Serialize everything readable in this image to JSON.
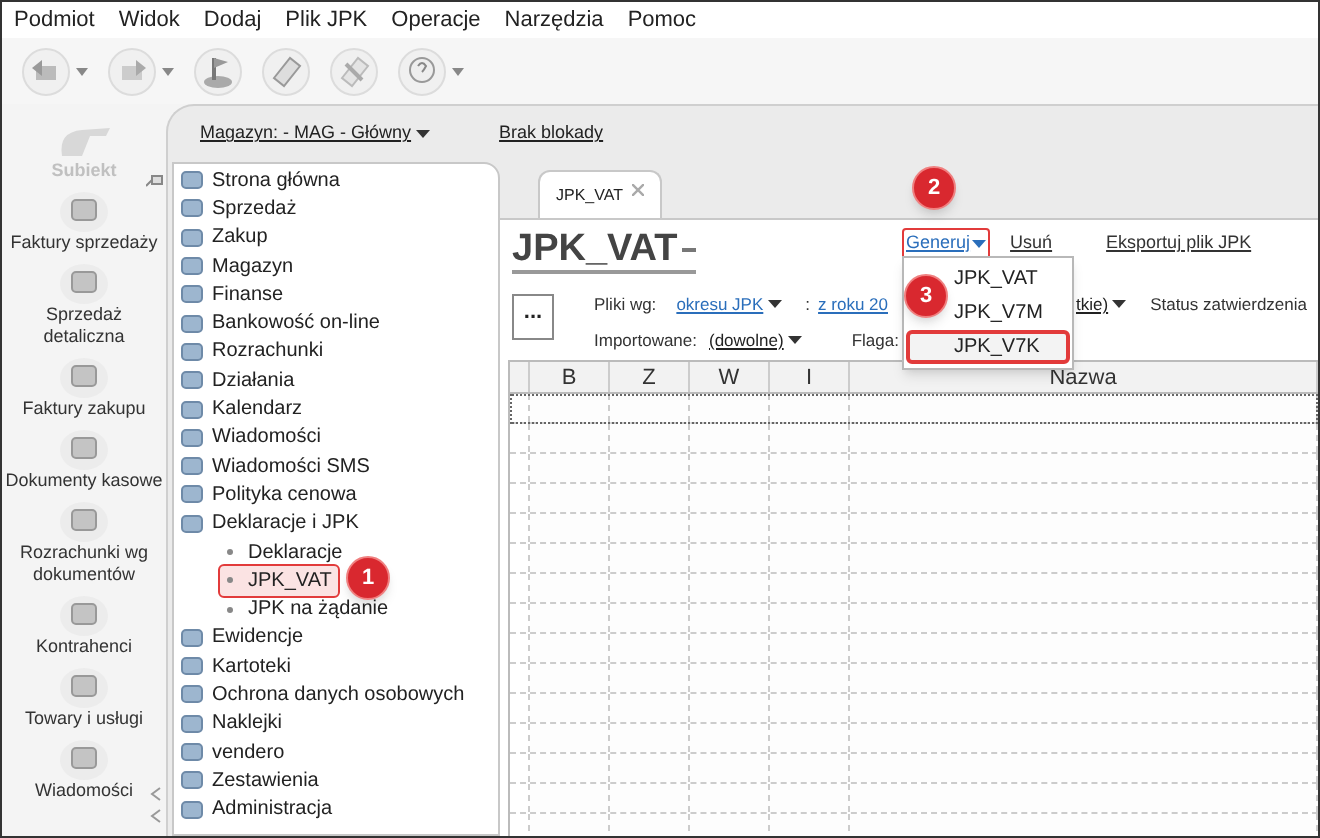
{
  "menu_bar": [
    "Podmiot",
    "Widok",
    "Dodaj",
    "Plik JPK",
    "Operacje",
    "Narzędzia",
    "Pomoc"
  ],
  "toolbar": [
    {
      "menu": true
    },
    {
      "menu": true
    },
    {
      "menu": false
    },
    {
      "menu": false
    },
    {
      "menu": false
    },
    {
      "menu": true
    }
  ],
  "sidebar": {
    "logo": "Subiekt",
    "items": [
      "Faktury sprzedaży",
      "Sprzedaż detaliczna",
      "Faktury zakupu",
      "Dokumenty kasowe",
      "Rozrachunki wg dokumentów",
      "Kontrahenci",
      "Towary i usługi",
      "Wiadomości"
    ]
  },
  "top_bar": {
    "warehouse": "Magazyn: - MAG - Główny",
    "lock": "Brak blokady"
  },
  "tree": [
    {
      "label": "Strona główna",
      "selected": false
    },
    {
      "label": "Sprzedaż",
      "selected": false
    },
    {
      "label": "Zakup",
      "selected": false
    },
    {
      "label": "Magazyn",
      "selected": false
    },
    {
      "label": "Finanse",
      "selected": false
    },
    {
      "label": "Bankowość on-line",
      "selected": false
    },
    {
      "label": "Rozrachunki",
      "selected": false
    },
    {
      "label": "Działania",
      "selected": false
    },
    {
      "label": "Kalendarz",
      "selected": false
    },
    {
      "label": "Wiadomości",
      "selected": false
    },
    {
      "label": "Wiadomości SMS",
      "selected": false
    },
    {
      "label": "Polityka cenowa",
      "selected": false
    },
    {
      "label": "Deklaracje i JPK",
      "selected": false,
      "children": [
        {
          "label": "Deklaracje",
          "selected": false,
          "marked": false
        },
        {
          "label": "JPK_VAT",
          "selected": true,
          "marked": true
        },
        {
          "label": "JPK na żądanie",
          "selected": false,
          "marked": false
        }
      ]
    },
    {
      "label": "Ewidencje",
      "selected": false
    },
    {
      "label": "Kartoteki",
      "selected": false
    },
    {
      "label": "Ochrona danych osobowych",
      "selected": false
    },
    {
      "label": "Naklejki",
      "selected": false
    },
    {
      "label": "vendero",
      "selected": false
    },
    {
      "label": "Zestawienia",
      "selected": false
    },
    {
      "label": "Administracja",
      "selected": false
    }
  ],
  "tabs": [
    {
      "label": "JPK_VAT",
      "selected": true
    }
  ],
  "title": "JPK_VAT",
  "actions": [
    {
      "label": "Generuj",
      "menu": true,
      "marked": true
    },
    {
      "label": "Usuń",
      "menu": false,
      "marked": false
    },
    {
      "label": "Eksportuj plik JPK",
      "menu": false,
      "marked": false
    }
  ],
  "dropdown": [
    {
      "label": "JPK_VAT",
      "marked": false
    },
    {
      "label": "JPK_V7M",
      "marked": false
    },
    {
      "label": "JPK_V7K",
      "marked": true
    }
  ],
  "filters": {
    "row_1": [
      {
        "kind": "label",
        "text": "Pliki wg:"
      },
      {
        "kind": "link",
        "text": "okresu JPK",
        "menu": true
      },
      {
        "kind": "label",
        "text": ":"
      },
      {
        "kind": "link",
        "text": "z roku 20",
        "menu": false
      },
      {
        "kind": "link",
        "text": "tkie)",
        "menu": true
      },
      {
        "kind": "label",
        "text": "Status zatwierdzenia"
      }
    ],
    "row_2": [
      {
        "kind": "label",
        "text": "Importowane:"
      },
      {
        "kind": "link",
        "text": "(dowolne)",
        "menu": true
      },
      {
        "kind": "label",
        "text": "Flaga:"
      }
    ]
  },
  "more_button": "...",
  "table": {
    "columns": [
      "B",
      "Z",
      "W",
      "I",
      "Nazwa"
    ]
  },
  "callouts": [
    "1",
    "2",
    "3"
  ]
}
